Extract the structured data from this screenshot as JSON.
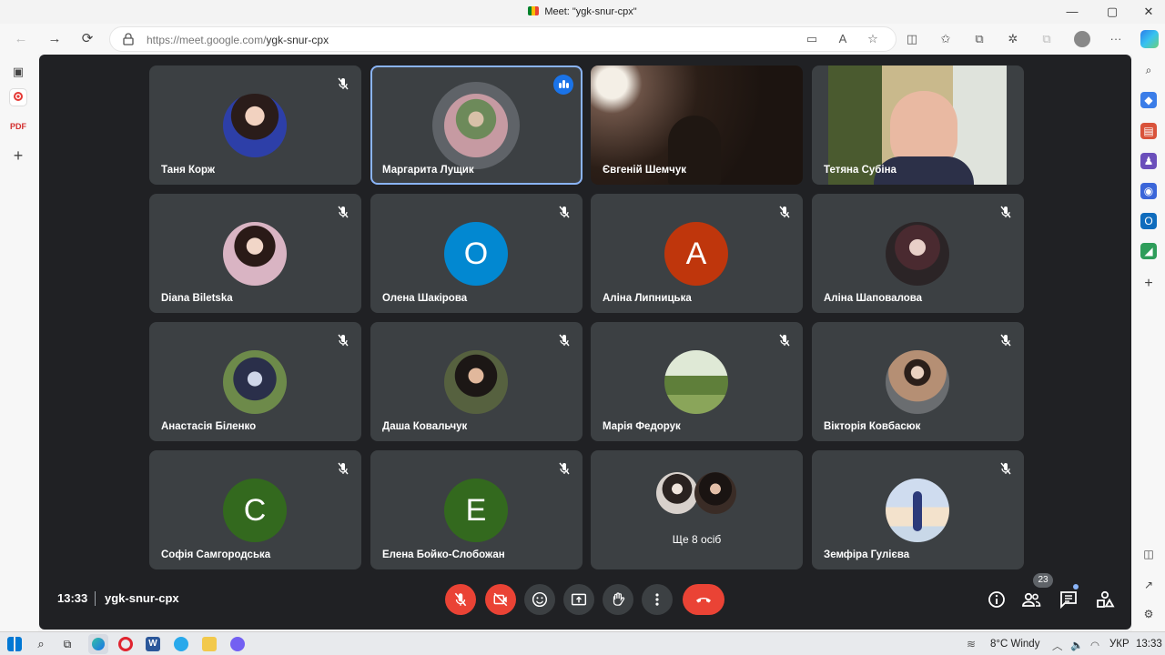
{
  "window": {
    "title": "Meet: \"ygk-snur-cpx\"",
    "minimize": "—",
    "maximize": "▢",
    "close": "✕"
  },
  "browser": {
    "url_host": "https://meet.google.com/",
    "url_path": "ygk-snur-cpx"
  },
  "participants": [
    {
      "name": "Таня Корж",
      "type": "photo",
      "muted": true
    },
    {
      "name": "Маргарита Лущик",
      "type": "photo",
      "speaking": true
    },
    {
      "name": "Євгеній Шемчук",
      "type": "video"
    },
    {
      "name": "Тетяна Субіна",
      "type": "video"
    },
    {
      "name": "Diana Biletska",
      "type": "photo",
      "muted": true
    },
    {
      "name": "Олена Шакірова",
      "type": "letter",
      "letter": "О",
      "color": "#0288d1",
      "muted": true
    },
    {
      "name": "Аліна Липницька",
      "type": "letter",
      "letter": "А",
      "color": "#bf360c",
      "muted": true
    },
    {
      "name": "Аліна Шаповалова",
      "type": "photo",
      "muted": true
    },
    {
      "name": "Анастасія Біленко",
      "type": "photo",
      "muted": true
    },
    {
      "name": "Даша Ковальчук",
      "type": "photo",
      "muted": true
    },
    {
      "name": "Марія Федорук",
      "type": "photo",
      "muted": true
    },
    {
      "name": "Вікторія Ковбасюк",
      "type": "photo",
      "muted": true
    },
    {
      "name": "Софія Самгородська",
      "type": "letter",
      "letter": "С",
      "color": "#33691e",
      "muted": true
    },
    {
      "name": "Елена Бойко-Слобожан",
      "type": "letter",
      "letter": "Е",
      "color": "#33691e",
      "muted": true
    },
    {
      "name": "Ще 8 осіб",
      "type": "others"
    },
    {
      "name": "Земфіра Гулієва",
      "type": "photo",
      "muted": true
    }
  ],
  "controls": {
    "time": "13:33",
    "meeting_code": "ygk-snur-cpx",
    "participants_count": "23"
  },
  "taskbar": {
    "weather": "8°C  Windy",
    "language": "УКР",
    "time": "13:33"
  },
  "colors": {
    "meet_bg": "#202124",
    "tile_bg": "#3c4043",
    "danger": "#ea4335",
    "accent": "#1a73e8"
  }
}
